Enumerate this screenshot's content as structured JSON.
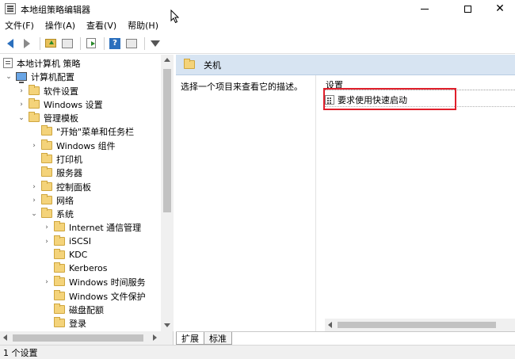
{
  "window": {
    "title": "本地组策略编辑器",
    "controls": {
      "minimize": "—",
      "maximize": "☐",
      "close": "✕"
    }
  },
  "menu": {
    "items": [
      {
        "label": "文件(F)"
      },
      {
        "label": "操作(A)"
      },
      {
        "label": "查看(V)"
      },
      {
        "label": "帮助(H)"
      }
    ]
  },
  "toolbar": {
    "icons": [
      "back-arrow-icon",
      "forward-arrow-icon",
      "up-folder-icon",
      "show-hide-tree-icon",
      "export-list-icon",
      "help-icon",
      "properties-icon",
      "filter-icon"
    ],
    "help_glyph": "?"
  },
  "tree": {
    "items": [
      {
        "label": "本地计算机 策略",
        "icon": "policy-icon",
        "expander": ""
      },
      {
        "label": "计算机配置",
        "icon": "computer-icon",
        "expander": "⌄"
      },
      {
        "label": "软件设置",
        "icon": "folder-icon",
        "expander": "›"
      },
      {
        "label": "Windows 设置",
        "icon": "folder-icon",
        "expander": "›"
      },
      {
        "label": "管理模板",
        "icon": "folder-icon",
        "expander": "⌄"
      },
      {
        "label": "\"开始\"菜单和任务栏",
        "icon": "folder-icon",
        "expander": ""
      },
      {
        "label": "Windows 组件",
        "icon": "folder-icon",
        "expander": "›"
      },
      {
        "label": "打印机",
        "icon": "folder-icon",
        "expander": ""
      },
      {
        "label": "服务器",
        "icon": "folder-icon",
        "expander": ""
      },
      {
        "label": "控制面板",
        "icon": "folder-icon",
        "expander": "›"
      },
      {
        "label": "网络",
        "icon": "folder-icon",
        "expander": "›"
      },
      {
        "label": "系统",
        "icon": "folder-icon",
        "expander": "⌄"
      },
      {
        "label": "Internet 通信管理",
        "icon": "folder-icon",
        "expander": "›"
      },
      {
        "label": "iSCSI",
        "icon": "folder-icon",
        "expander": "›"
      },
      {
        "label": "KDC",
        "icon": "folder-icon",
        "expander": ""
      },
      {
        "label": "Kerberos",
        "icon": "folder-icon",
        "expander": ""
      },
      {
        "label": "Windows 时间服务",
        "icon": "folder-icon",
        "expander": "›"
      },
      {
        "label": "Windows 文件保护",
        "icon": "folder-icon",
        "expander": ""
      },
      {
        "label": "磁盘配额",
        "icon": "folder-icon",
        "expander": ""
      },
      {
        "label": "登录",
        "icon": "folder-icon",
        "expander": ""
      }
    ]
  },
  "details": {
    "header_title": "关机",
    "description": "选择一个项目来查看它的描述。",
    "column_header": "设置",
    "settings": [
      {
        "label": "要求使用快速启动",
        "icon": "setting-icon",
        "highlighted": true
      }
    ],
    "highlight_color": "#e01f2b"
  },
  "tabs": [
    {
      "label": "扩展",
      "active": true
    },
    {
      "label": "标准",
      "active": false
    }
  ],
  "status": {
    "text": "1 个设置"
  }
}
